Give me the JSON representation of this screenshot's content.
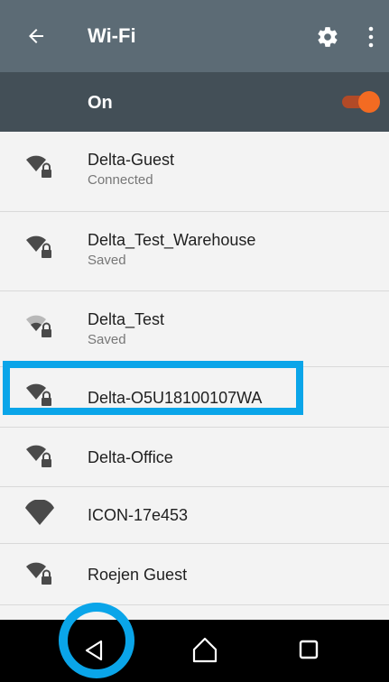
{
  "app_bar": {
    "title": "Wi-Fi",
    "back_icon": "arrow-back-icon",
    "settings_icon": "gear-icon",
    "overflow_icon": "more-vert-icon",
    "background_color": "#5c6b75"
  },
  "wifi_switch": {
    "label": "On",
    "state": true,
    "accent_color": "#f36b22",
    "background_color": "#434f57"
  },
  "networks": [
    {
      "ssid": "Delta-Guest",
      "status": "Connected",
      "secured": true,
      "signal": "strong"
    },
    {
      "ssid": "Delta_Test_Warehouse",
      "status": "Saved",
      "secured": true,
      "signal": "strong"
    },
    {
      "ssid": "Delta_Test",
      "status": "Saved",
      "secured": true,
      "signal": "weak"
    },
    {
      "ssid": "Delta-O5U18100107WA",
      "status": "",
      "secured": true,
      "signal": "strong"
    },
    {
      "ssid": "Delta-Office",
      "status": "",
      "secured": true,
      "signal": "strong"
    },
    {
      "ssid": "ICON-17e453",
      "status": "",
      "secured": false,
      "signal": "strong"
    },
    {
      "ssid": "Roejen Guest",
      "status": "",
      "secured": true,
      "signal": "strong"
    }
  ],
  "nav_bar": {
    "back_icon": "nav-back-triangle-icon",
    "home_icon": "nav-home-icon",
    "recents_icon": "nav-recents-square-icon"
  },
  "annotations": {
    "highlight_color": "#0aa5e9"
  }
}
